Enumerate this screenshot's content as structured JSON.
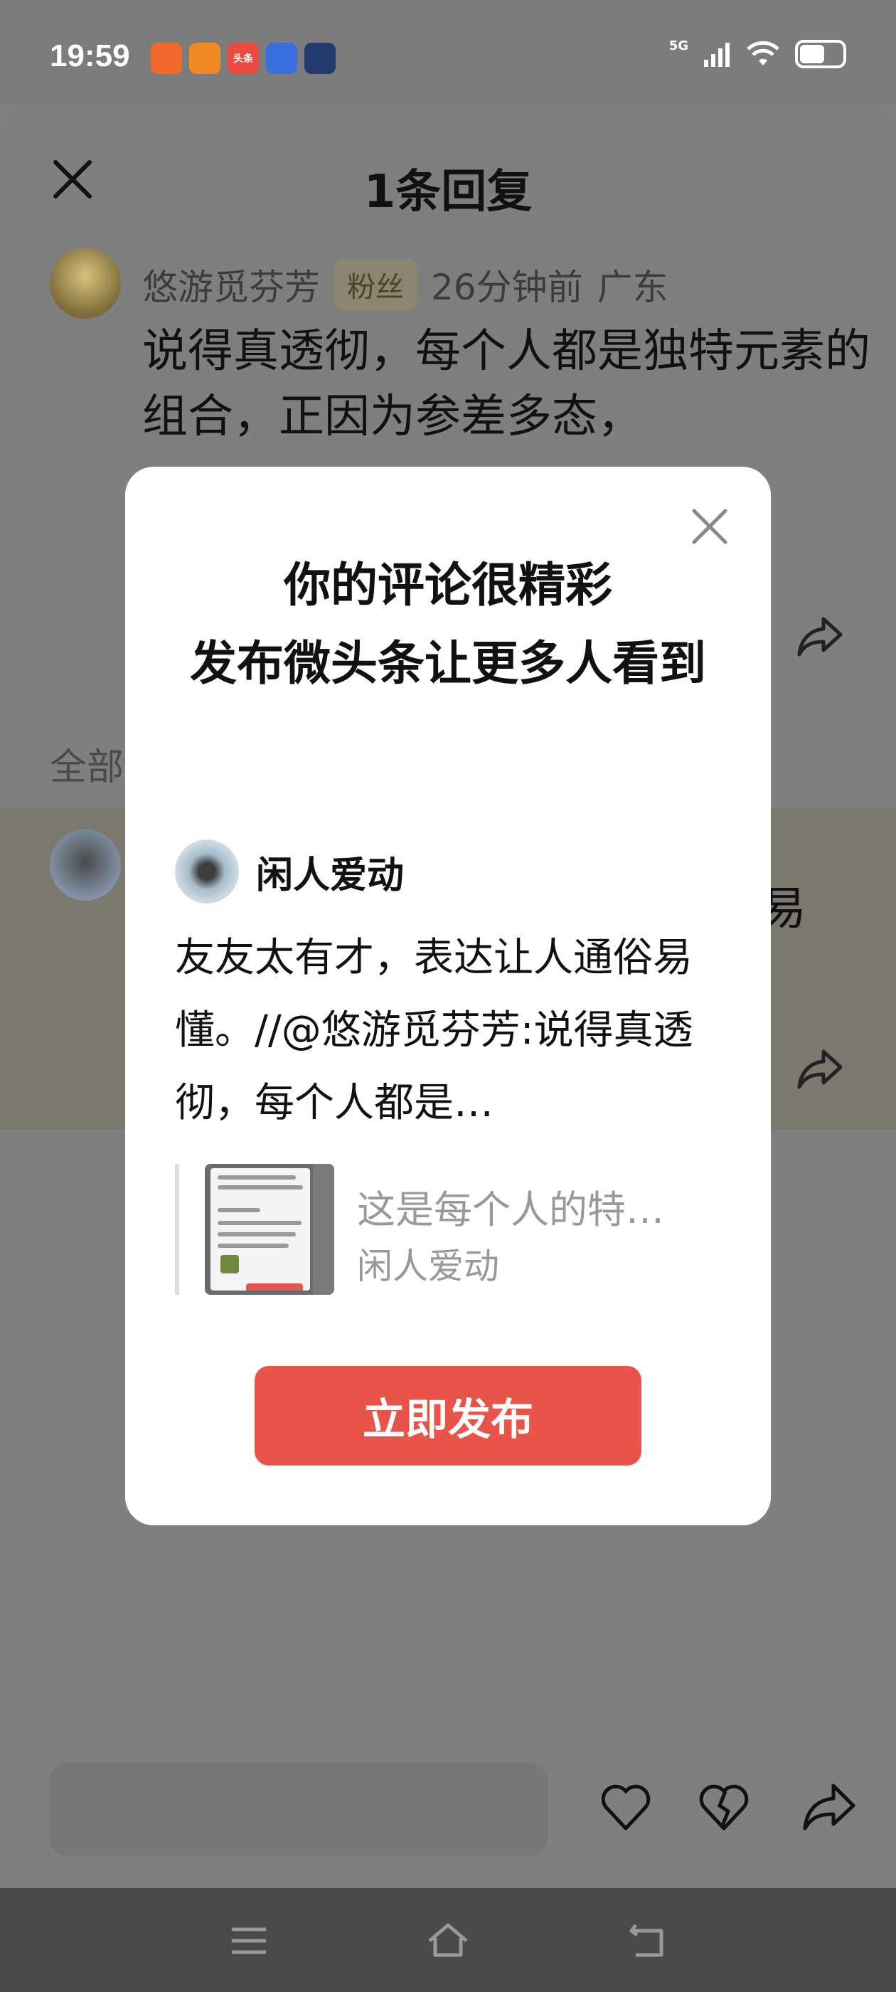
{
  "status_bar": {
    "time": "19:59",
    "network": "5G",
    "apps": [
      {
        "icon": "kuaishou-icon",
        "color": "#f2692b",
        "label": ""
      },
      {
        "icon": "alibaba-1688-icon",
        "color": "#f08a24",
        "label": ""
      },
      {
        "icon": "toutiao-icon",
        "color": "#e84a3f",
        "label": "头条"
      },
      {
        "icon": "baidu-icon",
        "color": "#3a6fe0",
        "label": ""
      },
      {
        "icon": "game-app-icon",
        "color": "#233a6e",
        "label": ""
      }
    ]
  },
  "sheet": {
    "title": "1条回复",
    "comment": {
      "author": "悠游觅芬芳",
      "badge": "粉丝",
      "time": "26分钟前",
      "location": "广东",
      "text": "说得真透彻，每个人都是独特元素的组合，正因为参差多态，"
    },
    "all_label": "全部",
    "reply_fragment": "易"
  },
  "modal": {
    "title_line1": "你的评论很精彩",
    "title_line2": "发布微头条让更多人看到",
    "author": "闲人爱动",
    "text": "友友太有才，表达让人通俗易懂。//@悠游觅芬芳:说得真透彻，每个人都是…",
    "quote_title": "这是每个人的特…",
    "quote_author": "闲人爱动",
    "publish_label": "立即发布"
  },
  "colors": {
    "accent": "#e8534a",
    "overlay": "#808080"
  }
}
